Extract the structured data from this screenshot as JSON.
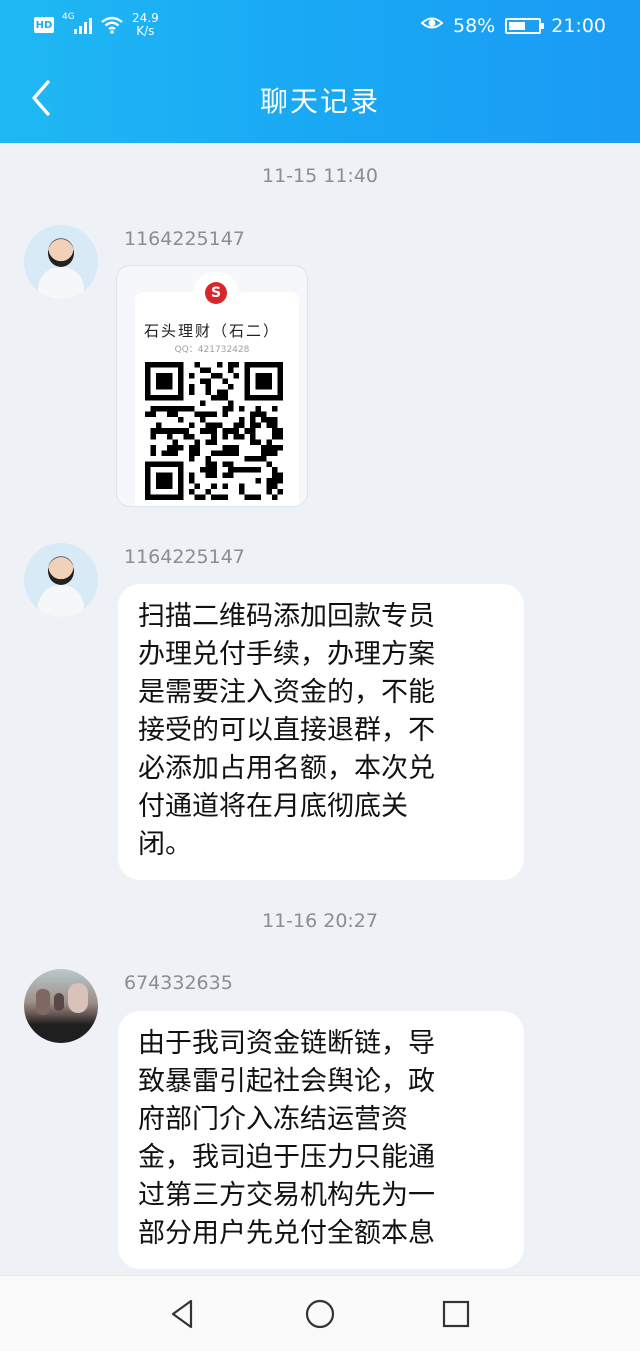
{
  "status_bar": {
    "hd": "HD",
    "network": "4G",
    "speed": "24.9\nK/s",
    "battery": "58%",
    "battery_level": 0.58,
    "time": "21:00"
  },
  "nav": {
    "title": "聊天记录",
    "back_icon": "chevron-left-icon"
  },
  "messages": [
    {
      "time": "11-15 11:40"
    },
    {
      "sender": "1164225147",
      "type": "qr-image",
      "card": {
        "logo": "S",
        "name": "石头理财（石二）",
        "qq": "QQ：421732428"
      }
    },
    {
      "sender": "1164225147",
      "type": "text",
      "text": "扫描二维码添加回款专员\n办理兑付手续，办理方案\n是需要注入资金的，不能\n接受的可以直接退群，不\n必添加占用名额，本次兑\n付通道将在月底彻底关\n闭。"
    },
    {
      "time": "11-16 20:27"
    },
    {
      "sender": "674332635",
      "type": "text",
      "text": "由于我司资金链断链，导\n致暴雷引起社会舆论，政\n府部门介入冻结运营资\n金，我司迫于压力只能通\n过第三方交易机构先为一\n部分用户先兑付全额本息"
    }
  ],
  "system_nav": {
    "back_icon": "triangle-back-icon",
    "home_icon": "circle-home-icon",
    "recents_icon": "square-recents-icon"
  },
  "colors": {
    "header_start": "#1fb8f3",
    "header_end": "#1a9bf5",
    "chat_bg": "#eef1f6",
    "bubble_bg": "#ffffff",
    "meta_text": "#8a8d93"
  }
}
